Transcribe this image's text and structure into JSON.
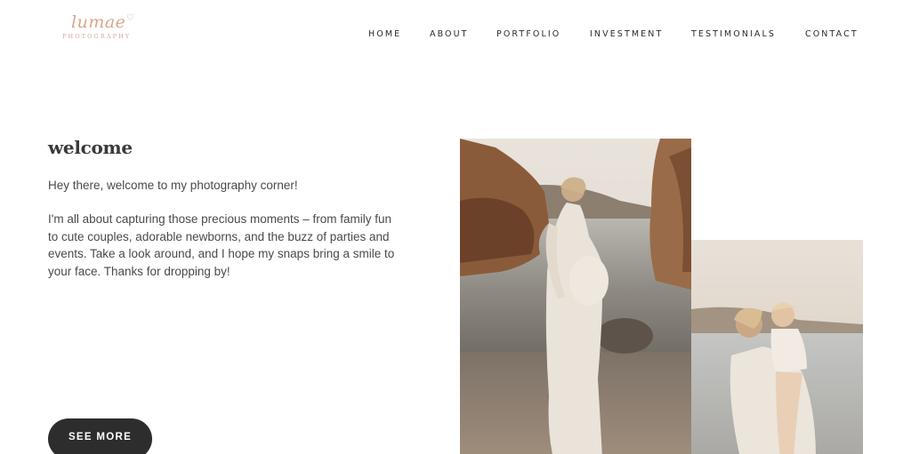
{
  "brand": {
    "script": "lumae",
    "sub": "PHOTOGRAPHY"
  },
  "nav": {
    "home": "HOME",
    "about": "ABOUT",
    "portfolio": "PORTFOLIO",
    "investment": "INVESTMENT",
    "testimonials": "TESTIMONIALS",
    "contact": "CONTACT"
  },
  "welcome": {
    "title": "welcome",
    "intro": "Hey there, welcome to my photography corner!",
    "body": "I'm all about capturing those precious moments – from family fun to cute couples, adorable newborns, and the buzz of parties and events. Take a look around, and I hope my snaps bring a smile to your face. Thanks for dropping by!",
    "button": "SEE MORE"
  },
  "images": {
    "photo1": "pregnant-woman-beach-photo",
    "photo2": "mother-child-beach-photo"
  },
  "colors": {
    "brand": "#d9a58b",
    "button": "#2d2d2d",
    "text": "#4a4a4a"
  }
}
